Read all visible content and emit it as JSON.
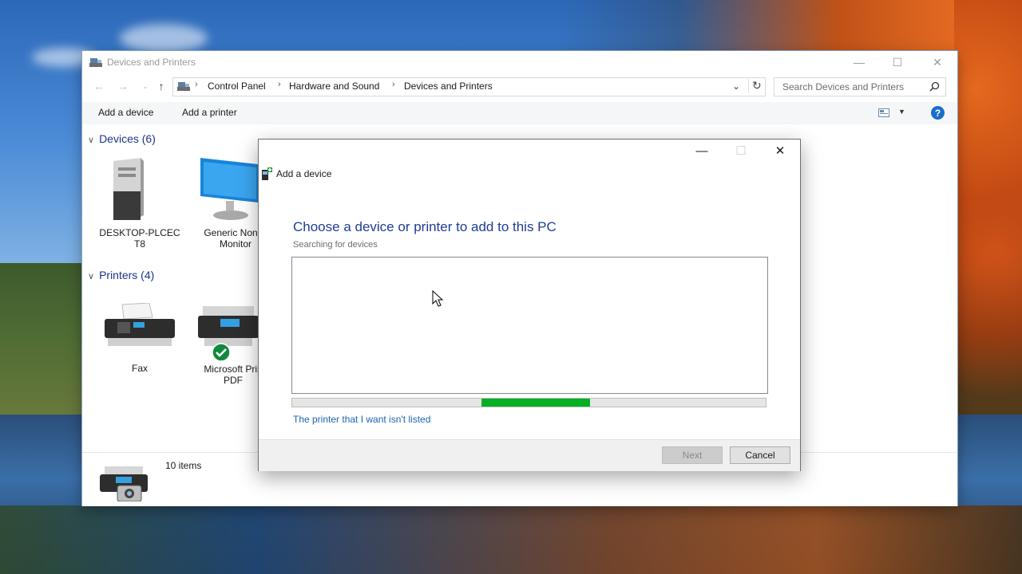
{
  "explorer": {
    "title": "Devices and Printers",
    "breadcrumbs": [
      "Control Panel",
      "Hardware and Sound",
      "Devices and Printers"
    ],
    "search_placeholder": "Search Devices and Printers",
    "commands": {
      "add_device": "Add a device",
      "add_printer": "Add a printer"
    },
    "groups": {
      "devices": {
        "title": "Devices (6)",
        "items": [
          {
            "label_line1": "DESKTOP-PLCEC",
            "label_line2": "T8",
            "icon": "computer-tower-icon"
          },
          {
            "label_line1": "Generic Non-P",
            "label_line2": "Monitor",
            "icon": "monitor-icon"
          }
        ]
      },
      "printers": {
        "title": "Printers (4)",
        "items": [
          {
            "label_line1": "Fax",
            "label_line2": "",
            "icon": "fax-icon"
          },
          {
            "label_line1": "Microsoft Prin",
            "label_line2": "PDF",
            "icon": "printer-icon",
            "status": "default-printer-check-icon"
          }
        ]
      }
    },
    "status": {
      "item_count": "10 items",
      "icon": "camera-printer-icon"
    }
  },
  "dialog": {
    "title": "Add a device",
    "heading": "Choose a device or printer to add to this PC",
    "subtext": "Searching for devices",
    "progress": {
      "start": 0.4,
      "end": 0.629
    },
    "link": "The printer that I want isn't listed",
    "buttons": {
      "next": "Next",
      "cancel": "Cancel"
    }
  },
  "colors": {
    "accent_blue": "#1e3c96",
    "link_blue": "#1a64b4",
    "progress_green": "#06b025",
    "help_blue": "#1a6ecb",
    "check_green": "#10893e"
  }
}
